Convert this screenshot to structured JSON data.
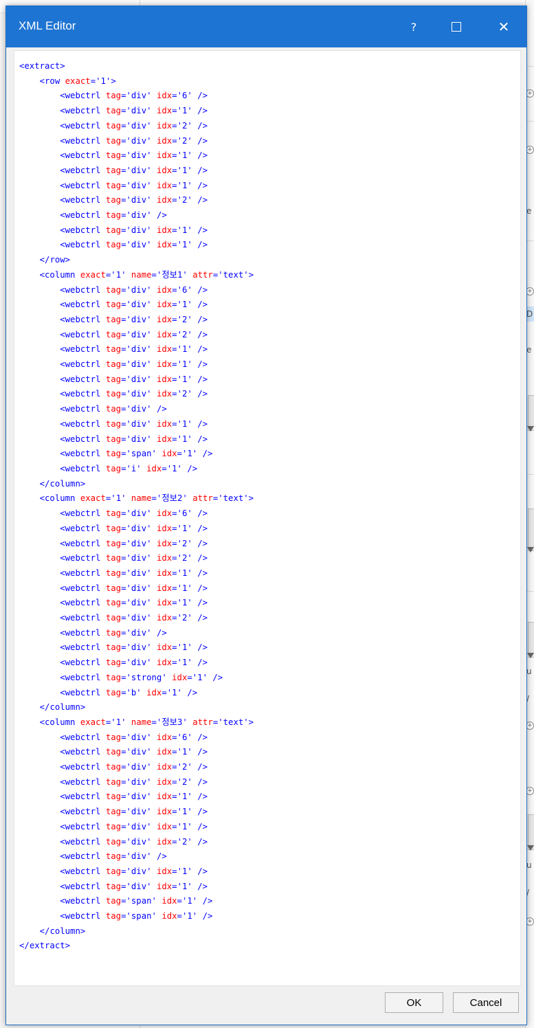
{
  "dialog": {
    "title": "XML Editor",
    "help_label": "?",
    "close_label": "✕",
    "ok_label": "OK",
    "cancel_label": "Cancel"
  },
  "background": {
    "fragments": [
      "e",
      "D",
      "e",
      "u",
      "/",
      "u",
      "/"
    ]
  },
  "xml_lines": [
    [
      0,
      "<extract>"
    ],
    [
      1,
      "<row exact='1'>"
    ],
    [
      2,
      "<webctrl tag='div' idx='6' />"
    ],
    [
      2,
      "<webctrl tag='div' idx='1' />"
    ],
    [
      2,
      "<webctrl tag='div' idx='2' />"
    ],
    [
      2,
      "<webctrl tag='div' idx='2' />"
    ],
    [
      2,
      "<webctrl tag='div' idx='1' />"
    ],
    [
      2,
      "<webctrl tag='div' idx='1' />"
    ],
    [
      2,
      "<webctrl tag='div' idx='1' />"
    ],
    [
      2,
      "<webctrl tag='div' idx='2' />"
    ],
    [
      2,
      "<webctrl tag='div' />"
    ],
    [
      2,
      "<webctrl tag='div' idx='1' />"
    ],
    [
      2,
      "<webctrl tag='div' idx='1' />"
    ],
    [
      1,
      "</row>"
    ],
    [
      1,
      "<column exact='1' name='정보1' attr='text'>"
    ],
    [
      2,
      "<webctrl tag='div' idx='6' />"
    ],
    [
      2,
      "<webctrl tag='div' idx='1' />"
    ],
    [
      2,
      "<webctrl tag='div' idx='2' />"
    ],
    [
      2,
      "<webctrl tag='div' idx='2' />"
    ],
    [
      2,
      "<webctrl tag='div' idx='1' />"
    ],
    [
      2,
      "<webctrl tag='div' idx='1' />"
    ],
    [
      2,
      "<webctrl tag='div' idx='1' />"
    ],
    [
      2,
      "<webctrl tag='div' idx='2' />"
    ],
    [
      2,
      "<webctrl tag='div' />"
    ],
    [
      2,
      "<webctrl tag='div' idx='1' />"
    ],
    [
      2,
      "<webctrl tag='div' idx='1' />"
    ],
    [
      2,
      "<webctrl tag='span' idx='1' />"
    ],
    [
      2,
      "<webctrl tag='i' idx='1' />"
    ],
    [
      1,
      "</column>"
    ],
    [
      1,
      "<column exact='1' name='정보2' attr='text'>"
    ],
    [
      2,
      "<webctrl tag='div' idx='6' />"
    ],
    [
      2,
      "<webctrl tag='div' idx='1' />"
    ],
    [
      2,
      "<webctrl tag='div' idx='2' />"
    ],
    [
      2,
      "<webctrl tag='div' idx='2' />"
    ],
    [
      2,
      "<webctrl tag='div' idx='1' />"
    ],
    [
      2,
      "<webctrl tag='div' idx='1' />"
    ],
    [
      2,
      "<webctrl tag='div' idx='1' />"
    ],
    [
      2,
      "<webctrl tag='div' idx='2' />"
    ],
    [
      2,
      "<webctrl tag='div' />"
    ],
    [
      2,
      "<webctrl tag='div' idx='1' />"
    ],
    [
      2,
      "<webctrl tag='div' idx='1' />"
    ],
    [
      2,
      "<webctrl tag='strong' idx='1' />"
    ],
    [
      2,
      "<webctrl tag='b' idx='1' />"
    ],
    [
      1,
      "</column>"
    ],
    [
      1,
      "<column exact='1' name='정보3' attr='text'>"
    ],
    [
      2,
      "<webctrl tag='div' idx='6' />"
    ],
    [
      2,
      "<webctrl tag='div' idx='1' />"
    ],
    [
      2,
      "<webctrl tag='div' idx='2' />"
    ],
    [
      2,
      "<webctrl tag='div' idx='2' />"
    ],
    [
      2,
      "<webctrl tag='div' idx='1' />"
    ],
    [
      2,
      "<webctrl tag='div' idx='1' />"
    ],
    [
      2,
      "<webctrl tag='div' idx='1' />"
    ],
    [
      2,
      "<webctrl tag='div' idx='2' />"
    ],
    [
      2,
      "<webctrl tag='div' />"
    ],
    [
      2,
      "<webctrl tag='div' idx='1' />"
    ],
    [
      2,
      "<webctrl tag='div' idx='1' />"
    ],
    [
      2,
      "<webctrl tag='span' idx='1' />"
    ],
    [
      2,
      "<webctrl tag='span' idx='1' />"
    ],
    [
      1,
      "</column>"
    ],
    [
      0,
      "</extract>"
    ]
  ],
  "colors": {
    "titlebar": "#1e74d2",
    "xml_tag": "#0000ff",
    "xml_attr": "#ff0000",
    "xml_value": "#0000ff"
  }
}
